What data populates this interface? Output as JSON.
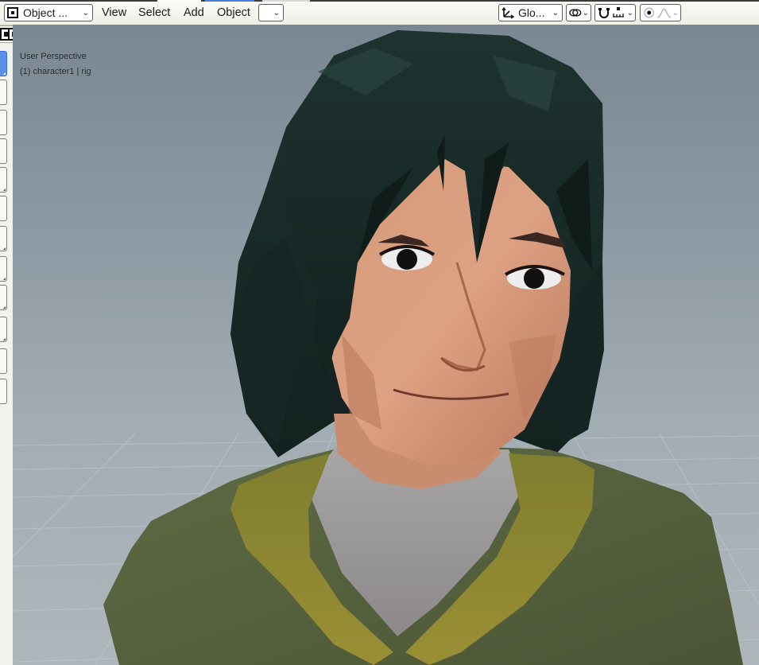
{
  "header": {
    "mode_label": "Object ...",
    "menus": [
      "View",
      "Select",
      "Add",
      "Object"
    ],
    "orientation_label": "Glo..."
  },
  "viewport": {
    "perspective_label": "User Perspective",
    "object_label": "(1) character1 | rig"
  },
  "icons": {
    "mode": "object-mode-icon",
    "orientation": "transform-orientation-icon",
    "pivot": "pivot-point-icon",
    "snap": "snap-magnet-icon",
    "snap_target": "snap-increment-icon",
    "proportional": "proportional-editing-icon",
    "falloff": "falloff-curve-icon",
    "select_modes": [
      "select-new-icon",
      "select-extend-icon",
      "select-subtract-icon",
      "select-intersect-icon"
    ]
  },
  "colors": {
    "active_tool": "#5b8fe6",
    "header_bg": "#f5f6ef",
    "viewport_bg": "#8f9ba4"
  }
}
